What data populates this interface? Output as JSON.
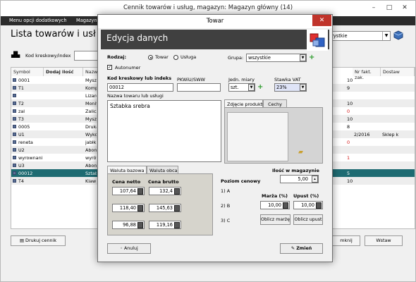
{
  "main": {
    "title": "Cennik towarów i usług, magazyn: Magazyn główny (14)",
    "menu": [
      "Menu opcji dodatkowych",
      "Magazyn"
    ],
    "heading": "Lista towarów i usł",
    "group_value": "szystkie",
    "kod_label": "Kod kreskowy/index",
    "columns": [
      "Symbol",
      "Dodaj ilość",
      "Nazw",
      "Nr fakt. zak.",
      "Dostaw"
    ],
    "rows": [
      {
        "symbol": "0001",
        "nazwa": "Mysz",
        "qty": "10",
        "nr": "",
        "dost": "",
        "qty_red": false
      },
      {
        "symbol": "T1",
        "nazwa": "Komp",
        "qty": "9",
        "nr": "",
        "dost": "",
        "qty_red": false
      },
      {
        "symbol": "",
        "nazwa": "Lizaro",
        "qty": "",
        "nr": "",
        "dost": "",
        "qty_red": false
      },
      {
        "symbol": "T2",
        "nazwa": "Monit",
        "qty": "10",
        "nr": "",
        "dost": "",
        "qty_red": false
      },
      {
        "symbol": "zal",
        "nazwa": "Zalicz",
        "qty": "0",
        "nr": "",
        "dost": "",
        "qty_red": true
      },
      {
        "symbol": "T3",
        "nazwa": "Mysz",
        "qty": "10",
        "nr": "",
        "dost": "",
        "qty_red": false
      },
      {
        "symbol": "0005",
        "nazwa": "Druka",
        "qty": "8",
        "nr": "",
        "dost": "",
        "qty_red": false
      },
      {
        "symbol": "U1",
        "nazwa": "Wyko",
        "qty": "",
        "nr": "2/2016",
        "dost": "Sklep k",
        "qty_red": false
      },
      {
        "symbol": "reneta",
        "nazwa": "jabłk",
        "qty": "0",
        "nr": "",
        "dost": "",
        "qty_red": true
      },
      {
        "symbol": "U2",
        "nazwa": "Abon",
        "qty": "",
        "nr": "",
        "dost": "",
        "qty_red": false
      },
      {
        "symbol": "wyrownani",
        "nazwa": "wyrów",
        "qty": "1",
        "nr": "",
        "dost": "",
        "qty_red": true
      },
      {
        "symbol": "U3",
        "nazwa": "Abon",
        "qty": "",
        "nr": "",
        "dost": "",
        "qty_red": false
      },
      {
        "symbol": "00012",
        "nazwa": "Sztab",
        "qty": "5",
        "nr": "",
        "dost": "",
        "qty_red": false
      },
      {
        "symbol": "T4",
        "nazwa": "Klaw",
        "qty": "10",
        "nr": "",
        "dost": "",
        "qty_red": false
      }
    ],
    "selected_row": 12,
    "print_label": "Drukuj cennik",
    "close_label": "mknij",
    "insert_label": "Wstaw"
  },
  "dialog": {
    "title": "Towar",
    "close_glyph": "✕",
    "heading": "Edycja danych",
    "rodzaj_label": "Rodzaj:",
    "rodzaj_towar": "Towar",
    "rodzaj_usluga": "Usługa",
    "autonumer_label": "Autonumer",
    "grupa_label": "Grupa:",
    "grupa_value": "wszystkie",
    "kod_label": "Kod kreskowy lub indeks",
    "kod_value": "00012",
    "pkwiu_label": "PKWiU/SWW",
    "pkwiu_value": "",
    "jm_label": "Jedn. miary",
    "jm_value": "szt.",
    "vat_label": "Stawka VAT",
    "vat_value": "23%",
    "nazwa_label": "Nazwa towaru lub usługi",
    "nazwa_value": "Sztabka srebra",
    "photo_tabs": [
      "Zdjęcie produktu",
      "Cechy"
    ],
    "currency_tabs": [
      "Waluta bazowa",
      "Waluta obca"
    ],
    "netto_label": "Cena netto",
    "brutto_label": "Cena brutto",
    "prices": [
      {
        "netto": "107,64",
        "brutto": "132,4"
      },
      {
        "netto": "118,40",
        "brutto": "145,63"
      },
      {
        "netto": "96,88",
        "brutto": "119,16"
      }
    ],
    "ilosc_label": "Ilość w magazynie",
    "ilosc_value": "5,00",
    "poziom_label": "Poziom cenowy",
    "levels": [
      "1) A",
      "2) B",
      "3) C"
    ],
    "marza_label": "Marża (%)",
    "upust_label": "Upust (%)",
    "marza_value": "10,00",
    "upust_value": "10,00",
    "oblicz_marze": "Oblicz marżę",
    "oblicz_upust": "Oblicz upust",
    "cancel_label": "Anuluj",
    "save_label": "Zmień"
  }
}
